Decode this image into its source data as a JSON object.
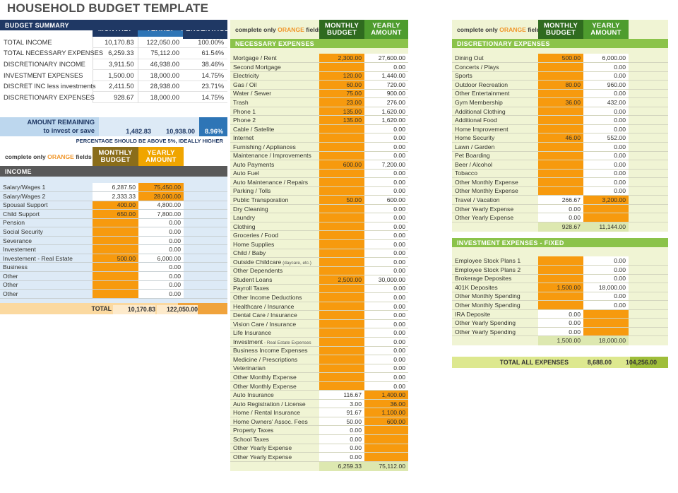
{
  "title": "HOUSEHOLD BUDGET TEMPLATE",
  "colors": {
    "navy": "#1f3864",
    "blue_mid": "#2e75b6",
    "blue_light": "#bdd7ee",
    "orange": "#f79a0e",
    "green_dark": "#2f6b1f",
    "green_mid": "#4e9c2e",
    "green_bar": "#8bc34a",
    "green_panel": "#f0f4d4",
    "gray_bar": "#595959"
  },
  "summary": {
    "tabs": [
      "MONTHLY",
      "YEARLY",
      "PERCENTAGE"
    ],
    "section_title": "BUDGET SUMMARY",
    "rows": [
      {
        "label": "TOTAL INCOME",
        "monthly": "10,170.83",
        "yearly": "122,050.00",
        "percentage": "100.00%"
      },
      {
        "label": "TOTAL NECESSARY EXPENSES",
        "monthly": "6,259.33",
        "yearly": "75,112.00",
        "percentage": "61.54%"
      },
      {
        "label": "DISCRETIONARY INCOME",
        "monthly": "3,911.50",
        "yearly": "46,938.00",
        "percentage": "38.46%"
      },
      {
        "label": "INVESTMENT EXPENSES",
        "monthly": "1,500.00",
        "yearly": "18,000.00",
        "percentage": "14.75%"
      },
      {
        "label": "DISCRET INC less investments",
        "monthly": "2,411.50",
        "yearly": "28,938.00",
        "percentage": "23.71%"
      },
      {
        "label": "DISCRETIONARY EXPENSES",
        "monthly": "928.67",
        "yearly": "18,000.00",
        "percentage": "14.75%"
      }
    ],
    "remaining": {
      "label_line1": "AMOUNT REMAINING",
      "label_line2": "to invest or save",
      "monthly": "1,482.83",
      "yearly": "10,938.00",
      "percentage": "8.96%"
    },
    "footnote": "PERCENTAGE SHOULD BE ABOVE 5%, IDEALLY HIGHER"
  },
  "income": {
    "hint_pre": "complete only ",
    "hint_orange": "ORANGE",
    "hint_post": " fields",
    "tabs": [
      "MONTHLY\nBUDGET",
      "YEARLY\nAMOUNT"
    ],
    "tab_monthly_l1": "MONTHLY",
    "tab_monthly_l2": "BUDGET",
    "tab_yearly_l1": "YEARLY",
    "tab_yearly_l2": "AMOUNT",
    "section_title": "INCOME",
    "rows": [
      {
        "label": "Salary/Wages 1",
        "monthly": "6,287.50",
        "yearly": "75,450.00",
        "m_fill": "white",
        "y_fill": "orange"
      },
      {
        "label": "Salary/Wages 2",
        "monthly": "2,333.33",
        "yearly": "28,000.00",
        "m_fill": "white",
        "y_fill": "orange"
      },
      {
        "label": "Spousal Support",
        "monthly": "400.00",
        "yearly": "4,800.00",
        "m_fill": "orange",
        "y_fill": "white"
      },
      {
        "label": "Child Support",
        "monthly": "650.00",
        "yearly": "7,800.00",
        "m_fill": "orange",
        "y_fill": "white"
      },
      {
        "label": "Pension",
        "monthly": "",
        "yearly": "0.00",
        "m_fill": "orange",
        "y_fill": "white"
      },
      {
        "label": "Social Security",
        "monthly": "",
        "yearly": "0.00",
        "m_fill": "orange",
        "y_fill": "white"
      },
      {
        "label": "Severance",
        "monthly": "",
        "yearly": "0.00",
        "m_fill": "orange",
        "y_fill": "white"
      },
      {
        "label": "Investement",
        "monthly": "",
        "yearly": "0.00",
        "m_fill": "orange",
        "y_fill": "white"
      },
      {
        "label": "Investement - Real Estate",
        "monthly": "500.00",
        "yearly": "6,000.00",
        "m_fill": "orange",
        "y_fill": "white"
      },
      {
        "label": "Business",
        "monthly": "",
        "yearly": "0.00",
        "m_fill": "orange",
        "y_fill": "white"
      },
      {
        "label": "Other",
        "monthly": "",
        "yearly": "0.00",
        "m_fill": "orange",
        "y_fill": "white"
      },
      {
        "label": "Other",
        "monthly": "",
        "yearly": "0.00",
        "m_fill": "orange",
        "y_fill": "white"
      },
      {
        "label": "Other",
        "monthly": "",
        "yearly": "0.00",
        "m_fill": "orange",
        "y_fill": "white"
      }
    ],
    "total_label": "TOTAL",
    "total_monthly": "10,170.83",
    "total_yearly": "122,050.00"
  },
  "necessary": {
    "hint_pre": "complete only ",
    "hint_orange": "ORANGE",
    "hint_post": " fields",
    "tab_monthly_l1": "MONTHLY",
    "tab_monthly_l2": "BUDGET",
    "tab_yearly_l1": "YEARLY",
    "tab_yearly_l2": "AMOUNT",
    "section_title": "NECESSARY EXPENSES",
    "rows": [
      {
        "label": "Mortgage / Rent",
        "monthly": "2,300.00",
        "yearly": "27,600.00",
        "m_fill": "orange",
        "y_fill": "white"
      },
      {
        "label": "Second Mortgage",
        "monthly": "",
        "yearly": "0.00",
        "m_fill": "orange",
        "y_fill": "white"
      },
      {
        "label": "Electricity",
        "monthly": "120.00",
        "yearly": "1,440.00",
        "m_fill": "orange",
        "y_fill": "white"
      },
      {
        "label": "Gas / Oil",
        "monthly": "60.00",
        "yearly": "720.00",
        "m_fill": "orange",
        "y_fill": "white"
      },
      {
        "label": "Water / Sewer",
        "monthly": "75.00",
        "yearly": "900.00",
        "m_fill": "orange",
        "y_fill": "white"
      },
      {
        "label": "Trash",
        "monthly": "23.00",
        "yearly": "276.00",
        "m_fill": "orange",
        "y_fill": "white"
      },
      {
        "label": "Phone 1",
        "monthly": "135.00",
        "yearly": "1,620.00",
        "m_fill": "orange",
        "y_fill": "white"
      },
      {
        "label": "Phone 2",
        "monthly": "135.00",
        "yearly": "1,620.00",
        "m_fill": "orange",
        "y_fill": "white"
      },
      {
        "label": "Cable / Satelite",
        "monthly": "",
        "yearly": "0.00",
        "m_fill": "orange",
        "y_fill": "white"
      },
      {
        "label": "Internet",
        "monthly": "",
        "yearly": "0.00",
        "m_fill": "orange",
        "y_fill": "white"
      },
      {
        "label": "Furnishing / Appliances",
        "monthly": "",
        "yearly": "0.00",
        "m_fill": "orange",
        "y_fill": "white"
      },
      {
        "label": "Maintenance / Improvements",
        "monthly": "",
        "yearly": "0.00",
        "m_fill": "orange",
        "y_fill": "white"
      },
      {
        "label": "Auto Payments",
        "monthly": "600.00",
        "yearly": "7,200.00",
        "m_fill": "orange",
        "y_fill": "white"
      },
      {
        "label": "Auto Fuel",
        "monthly": "",
        "yearly": "0.00",
        "m_fill": "orange",
        "y_fill": "white"
      },
      {
        "label": "Auto Maintenance / Repairs",
        "monthly": "",
        "yearly": "0.00",
        "m_fill": "orange",
        "y_fill": "white"
      },
      {
        "label": "Parking / Tolls",
        "monthly": "",
        "yearly": "0.00",
        "m_fill": "orange",
        "y_fill": "white"
      },
      {
        "label": "Public Transporation",
        "monthly": "50.00",
        "yearly": "600.00",
        "m_fill": "orange",
        "y_fill": "white"
      },
      {
        "label": "Dry Cleaning",
        "monthly": "",
        "yearly": "0.00",
        "m_fill": "orange",
        "y_fill": "white"
      },
      {
        "label": "Laundry",
        "monthly": "",
        "yearly": "0.00",
        "m_fill": "orange",
        "y_fill": "white"
      },
      {
        "label": "Clothing",
        "monthly": "",
        "yearly": "0.00",
        "m_fill": "orange",
        "y_fill": "white"
      },
      {
        "label": "Groceries / Food",
        "monthly": "",
        "yearly": "0.00",
        "m_fill": "orange",
        "y_fill": "white"
      },
      {
        "label": "Home Supplies",
        "monthly": "",
        "yearly": "0.00",
        "m_fill": "orange",
        "y_fill": "white"
      },
      {
        "label": "Child / Baby",
        "monthly": "",
        "yearly": "0.00",
        "m_fill": "orange",
        "y_fill": "white"
      },
      {
        "label": "Outside Childcare",
        "note": "(daycare, etc.)",
        "monthly": "",
        "yearly": "0.00",
        "m_fill": "orange",
        "y_fill": "white"
      },
      {
        "label": "Other Dependents",
        "monthly": "",
        "yearly": "0.00",
        "m_fill": "orange",
        "y_fill": "white"
      },
      {
        "label": "Student Loans",
        "monthly": "2,500.00",
        "yearly": "30,000.00",
        "m_fill": "orange",
        "y_fill": "white"
      },
      {
        "label": "Payroll Taxes",
        "monthly": "",
        "yearly": "0.00",
        "m_fill": "orange",
        "y_fill": "white"
      },
      {
        "label": "Other Income Deductions",
        "monthly": "",
        "yearly": "0.00",
        "m_fill": "orange",
        "y_fill": "white"
      },
      {
        "label": "Healthcare / Insurance",
        "monthly": "",
        "yearly": "0.00",
        "m_fill": "orange",
        "y_fill": "white"
      },
      {
        "label": "Dental Care / Insurance",
        "monthly": "",
        "yearly": "0.00",
        "m_fill": "orange",
        "y_fill": "white"
      },
      {
        "label": "Vision Care / Insurance",
        "monthly": "",
        "yearly": "0.00",
        "m_fill": "orange",
        "y_fill": "white"
      },
      {
        "label": "Life Insurance",
        "monthly": "",
        "yearly": "0.00",
        "m_fill": "orange",
        "y_fill": "white"
      },
      {
        "label": "Investment",
        "note": "- Real Estate Expenses",
        "monthly": "",
        "yearly": "0.00",
        "m_fill": "orange",
        "y_fill": "white"
      },
      {
        "label": "Business Income Expenses",
        "monthly": "",
        "yearly": "0.00",
        "m_fill": "orange",
        "y_fill": "white"
      },
      {
        "label": "Medicine / Prescriptions",
        "monthly": "",
        "yearly": "0.00",
        "m_fill": "orange",
        "y_fill": "white"
      },
      {
        "label": "Veterinarian",
        "monthly": "",
        "yearly": "0.00",
        "m_fill": "orange",
        "y_fill": "white"
      },
      {
        "label": "Other Monthly Expense",
        "monthly": "",
        "yearly": "0.00",
        "m_fill": "orange",
        "y_fill": "white"
      },
      {
        "label": "Other Monthly Expense",
        "monthly": "",
        "yearly": "0.00",
        "m_fill": "orange",
        "y_fill": "white"
      },
      {
        "label": "Auto Insurance",
        "monthly": "116.67",
        "yearly": "1,400.00",
        "m_fill": "white",
        "y_fill": "orange"
      },
      {
        "label": "Auto Registration / License",
        "monthly": "3.00",
        "yearly": "36.00",
        "m_fill": "white",
        "y_fill": "orange"
      },
      {
        "label": "Home / Rental Insurance",
        "monthly": "91.67",
        "yearly": "1,100.00",
        "m_fill": "white",
        "y_fill": "orange"
      },
      {
        "label": "Home Owners' Assoc. Fees",
        "monthly": "50.00",
        "yearly": "600.00",
        "m_fill": "white",
        "y_fill": "orange"
      },
      {
        "label": "Property Taxes",
        "monthly": "0.00",
        "yearly": "",
        "m_fill": "white",
        "y_fill": "orange"
      },
      {
        "label": "School Taxes",
        "monthly": "0.00",
        "yearly": "",
        "m_fill": "white",
        "y_fill": "orange"
      },
      {
        "label": "Other Yearly Expense",
        "monthly": "0.00",
        "yearly": "",
        "m_fill": "white",
        "y_fill": "orange"
      },
      {
        "label": "Other Yearly Expense",
        "monthly": "0.00",
        "yearly": "",
        "m_fill": "white",
        "y_fill": "orange"
      }
    ],
    "total_monthly": "6,259.33",
    "total_yearly": "75,112.00"
  },
  "discretionary": {
    "hint_pre": "complete only ",
    "hint_orange": "ORANGE",
    "hint_post": " fields",
    "tab_monthly_l1": "MONTHLY",
    "tab_monthly_l2": "BUDGET",
    "tab_yearly_l1": "YEARLY",
    "tab_yearly_l2": "AMOUNT",
    "section_title": "DISCRETIONARY EXPENSES",
    "rows": [
      {
        "label": "Dining Out",
        "monthly": "500.00",
        "yearly": "6,000.00",
        "m_fill": "orange",
        "y_fill": "white"
      },
      {
        "label": "Concerts / Plays",
        "monthly": "",
        "yearly": "0.00",
        "m_fill": "orange",
        "y_fill": "white"
      },
      {
        "label": "Sports",
        "monthly": "",
        "yearly": "0.00",
        "m_fill": "orange",
        "y_fill": "white"
      },
      {
        "label": "Outdoor Recreation",
        "monthly": "80.00",
        "yearly": "960.00",
        "m_fill": "orange",
        "y_fill": "white"
      },
      {
        "label": "Other Entertainment",
        "monthly": "",
        "yearly": "0.00",
        "m_fill": "orange",
        "y_fill": "white"
      },
      {
        "label": "Gym Membership",
        "monthly": "36.00",
        "yearly": "432.00",
        "m_fill": "orange",
        "y_fill": "white"
      },
      {
        "label": "Additional Clothing",
        "monthly": "",
        "yearly": "0.00",
        "m_fill": "orange",
        "y_fill": "white"
      },
      {
        "label": "Additional Food",
        "monthly": "",
        "yearly": "0.00",
        "m_fill": "orange",
        "y_fill": "white"
      },
      {
        "label": "Home Improvement",
        "monthly": "",
        "yearly": "0.00",
        "m_fill": "orange",
        "y_fill": "white"
      },
      {
        "label": "Home Security",
        "monthly": "46.00",
        "yearly": "552.00",
        "m_fill": "orange",
        "y_fill": "white"
      },
      {
        "label": "Lawn / Garden",
        "monthly": "",
        "yearly": "0.00",
        "m_fill": "orange",
        "y_fill": "white"
      },
      {
        "label": "Pet Boarding",
        "monthly": "",
        "yearly": "0.00",
        "m_fill": "orange",
        "y_fill": "white"
      },
      {
        "label": "Beer / Alcohol",
        "monthly": "",
        "yearly": "0.00",
        "m_fill": "orange",
        "y_fill": "white"
      },
      {
        "label": "Tobacco",
        "monthly": "",
        "yearly": "0.00",
        "m_fill": "orange",
        "y_fill": "white"
      },
      {
        "label": "Other Monthly Expense",
        "monthly": "",
        "yearly": "0.00",
        "m_fill": "orange",
        "y_fill": "white"
      },
      {
        "label": "Other Monthly Expense",
        "monthly": "",
        "yearly": "0.00",
        "m_fill": "orange",
        "y_fill": "white"
      },
      {
        "label": "Travel / Vacation",
        "monthly": "266.67",
        "yearly": "3,200.00",
        "m_fill": "white",
        "y_fill": "orange"
      },
      {
        "label": "Other Yearly Expense",
        "monthly": "0.00",
        "yearly": "",
        "m_fill": "white",
        "y_fill": "orange"
      },
      {
        "label": "Other Yearly Expense",
        "monthly": "0.00",
        "yearly": "",
        "m_fill": "white",
        "y_fill": "orange"
      }
    ],
    "total_monthly": "928.67",
    "total_yearly": "11,144.00"
  },
  "investment": {
    "section_title": "INVESTMENT EXPENSES - FIXED",
    "rows": [
      {
        "label": "Employee Stock Plans 1",
        "monthly": "",
        "yearly": "0.00",
        "m_fill": "orange",
        "y_fill": "white"
      },
      {
        "label": "Employee Stock Plans 2",
        "monthly": "",
        "yearly": "0.00",
        "m_fill": "orange",
        "y_fill": "white"
      },
      {
        "label": "Brokerage Deposites",
        "monthly": "",
        "yearly": "0.00",
        "m_fill": "orange",
        "y_fill": "white"
      },
      {
        "label": "401K Deposites",
        "monthly": "1,500.00",
        "yearly": "18,000.00",
        "m_fill": "orange",
        "y_fill": "white"
      },
      {
        "label": "Other Monthly Spending",
        "monthly": "",
        "yearly": "0.00",
        "m_fill": "orange",
        "y_fill": "white"
      },
      {
        "label": "Other Monthly Spending",
        "monthly": "",
        "yearly": "0.00",
        "m_fill": "orange",
        "y_fill": "white"
      },
      {
        "label": "IRA Deposite",
        "monthly": "0.00",
        "yearly": "",
        "m_fill": "white",
        "y_fill": "orange"
      },
      {
        "label": "Other Yearly Spending",
        "monthly": "0.00",
        "yearly": "",
        "m_fill": "white",
        "y_fill": "orange"
      },
      {
        "label": "Other Yearly Spending",
        "monthly": "0.00",
        "yearly": "",
        "m_fill": "white",
        "y_fill": "orange"
      }
    ],
    "total_monthly": "1,500.00",
    "total_yearly": "18,000.00"
  },
  "grand_total": {
    "label": "TOTAL ALL EXPENSES",
    "monthly": "8,688.00",
    "yearly": "104,256.00"
  }
}
